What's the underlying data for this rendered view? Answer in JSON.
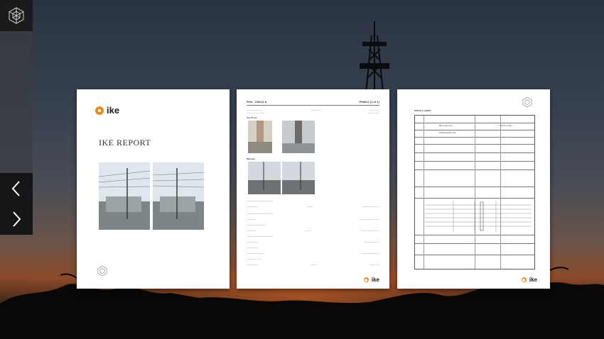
{
  "app": {
    "logo_icon": "hexagon-logo-icon"
  },
  "navigation": {
    "prev_icon": "chevron-left-icon",
    "next_icon": "chevron-right-icon"
  },
  "pages": [
    {
      "brand": "ike",
      "title": "IKE REPORT"
    },
    {
      "header_left": "PHIL_239n11 A",
      "header_right": "PHIM12 (1 of 1)",
      "section_top": "Top Photo",
      "section_mid": "Midspan",
      "brand": "ike"
    },
    {
      "form_label": "PROFILE SHEET",
      "field_a": "Blossom Ave.",
      "field_b": "Comes Caille",
      "field_c": "Philadelphia, PA",
      "brand": "ike"
    }
  ],
  "colors": {
    "brand_orange": "#f08a1c",
    "rail_dark": "#161618"
  }
}
